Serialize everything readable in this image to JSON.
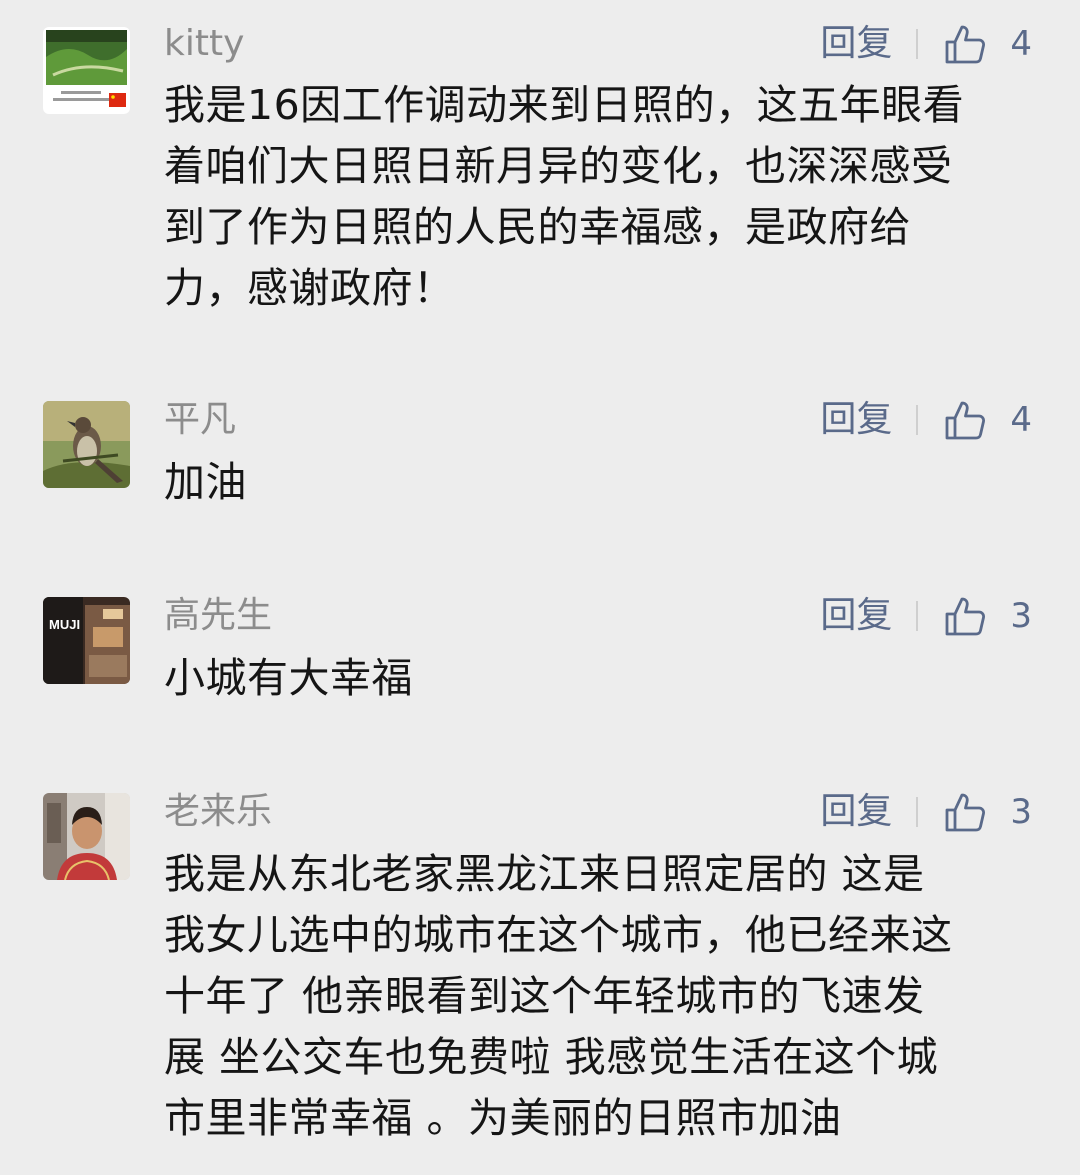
{
  "reply_label": "回复",
  "comments": [
    {
      "username": "kitty",
      "likes": "4",
      "lines": [
        "我是16因工作调动来到日照的，这五年眼看",
        "着咱们大日照日新月异的变化，也深深感受",
        "到了作为日照的人民的幸福感，是政府给",
        "力，感谢政府！"
      ]
    },
    {
      "username": "平凡",
      "likes": "4",
      "lines": [
        "加油"
      ]
    },
    {
      "username": "高先生",
      "likes": "3",
      "lines": [
        "小城有大幸福"
      ]
    },
    {
      "username": "老来乐",
      "likes": "3",
      "lines": [
        " 我是从东北老家黑龙江来日照定居的 这是",
        "我女儿选中的城市在这个城市，他已经来这",
        "十年了  他亲眼看到这个年轻城市的飞速发",
        "展 坐公交车也免费啦 我感觉生活在这个城",
        "市里非常幸福 。为美丽的日照市加油"
      ]
    }
  ],
  "icons": {
    "like": "thumbs-up-icon"
  },
  "colors": {
    "background": "#ededed",
    "link": "#5a6a8a",
    "username": "#8c8c8c",
    "text": "#151515"
  }
}
